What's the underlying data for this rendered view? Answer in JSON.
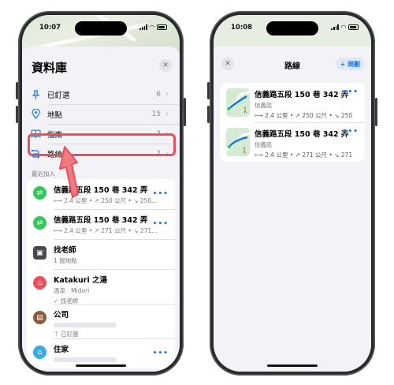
{
  "left_phone": {
    "status": {
      "time": "10:07"
    },
    "library": {
      "title": "資料庫",
      "categories": [
        {
          "label": "已釘選",
          "count": "6",
          "icon": "pin-icon"
        },
        {
          "label": "地點",
          "count": "15",
          "icon": "location-pin-icon"
        },
        {
          "label": "指南",
          "count": "2",
          "icon": "book-icon"
        },
        {
          "label": "路線",
          "count": "2",
          "icon": "route-icon"
        }
      ],
      "recent_label": "最近加入",
      "recent": [
        {
          "title": "信義路五段 150 巷 342 弄",
          "sub": "⟼ 2.4 公里 • ↗ 250 公尺 • ↘ 250...",
          "icon_color": "#34c759"
        },
        {
          "title": "信義路五段 150 巷 342 弄",
          "sub": "⟼ 2.4 公里 • ↗ 271 公尺 • ↘ 271...",
          "icon_color": "#34c759"
        },
        {
          "title": "找老師",
          "sub": "1 個地點"
        },
        {
          "title": "Katakuri 之湯",
          "sub": "溫泉 · Midori",
          "sub2": "✓ 找老師",
          "icon_color": "#e8505b"
        },
        {
          "title": "公司",
          "sub2": "已釘選",
          "icon_color": "#8a5a3a"
        },
        {
          "title": "住家",
          "icon_color": "#32ade6"
        }
      ]
    }
  },
  "right_phone": {
    "status": {
      "time": "10:08"
    },
    "header": {
      "title": "路線",
      "plan_label": "+ 規劃"
    },
    "routes": [
      {
        "title": "信義路五段 150 巷 342 弄",
        "district": "信義區",
        "meta": "⟼ 2.4 公里 • ↗ 250 公尺 • ↘ 250"
      },
      {
        "title": "信義路五段 150 巷 342 弄",
        "district": "信義區",
        "meta": "⟼ 2.4 公里 • ↗ 271 公尺 • ↘ 271"
      }
    ]
  },
  "colors": {
    "accent": "#1677e8",
    "highlight": "#e8505b",
    "green": "#34c759"
  }
}
